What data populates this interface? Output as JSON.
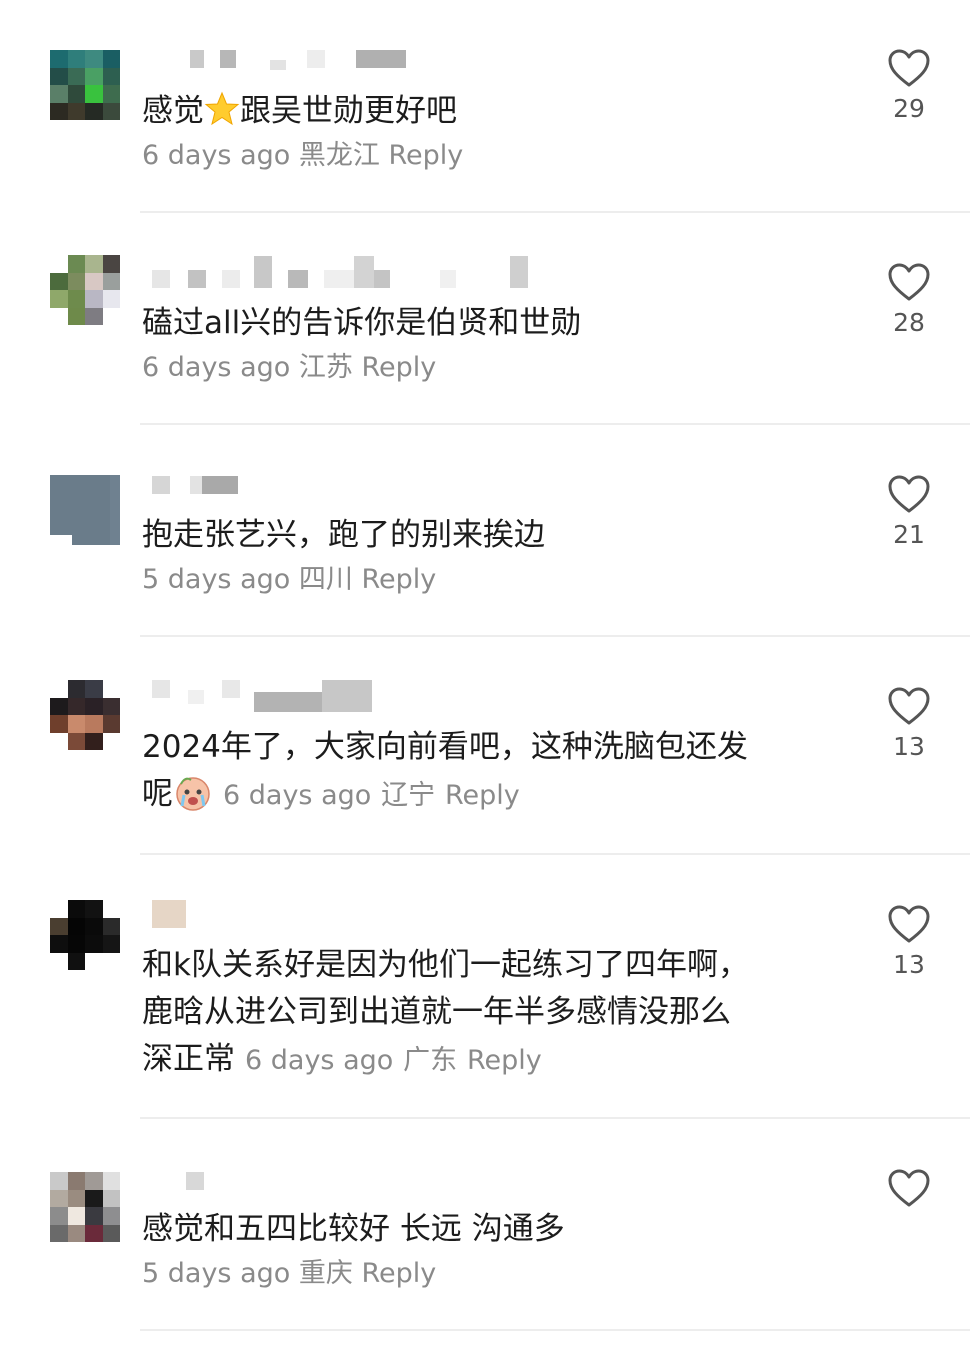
{
  "comments": [
    {
      "text_before": "感觉",
      "emoji": "star-emoji",
      "text_after": "跟吴世勋更好吧",
      "time": "6 days ago",
      "location": "黑龙江",
      "reply": "Reply",
      "likes": "29"
    },
    {
      "text": "磕过all兴的告诉你是伯贤和世勋",
      "time": "6 days ago",
      "location": "江苏",
      "reply": "Reply",
      "likes": "28"
    },
    {
      "text": "抱走张艺兴，跑了的别来挨边",
      "time": "5 days ago",
      "location": "四川",
      "reply": "Reply",
      "likes": "21"
    },
    {
      "line1": "2024年了，大家向前看吧，这种洗脑包还发",
      "line2": "呢",
      "emoji": "crying-face-emoji",
      "time": "6 days ago",
      "location": "辽宁",
      "reply": "Reply",
      "likes": "13"
    },
    {
      "line1": "和k队关系好是因为他们一起练习了四年啊，",
      "line2": "鹿晗从进公司到出道就一年半多感情没那么",
      "line3": "深正常",
      "time": "6 days ago",
      "location": "广东",
      "reply": "Reply",
      "likes": "13"
    },
    {
      "text": "感觉和五四比较好 长远 沟通多",
      "time": "5 days ago",
      "location": "重庆",
      "reply": "Reply",
      "likes": ""
    }
  ]
}
